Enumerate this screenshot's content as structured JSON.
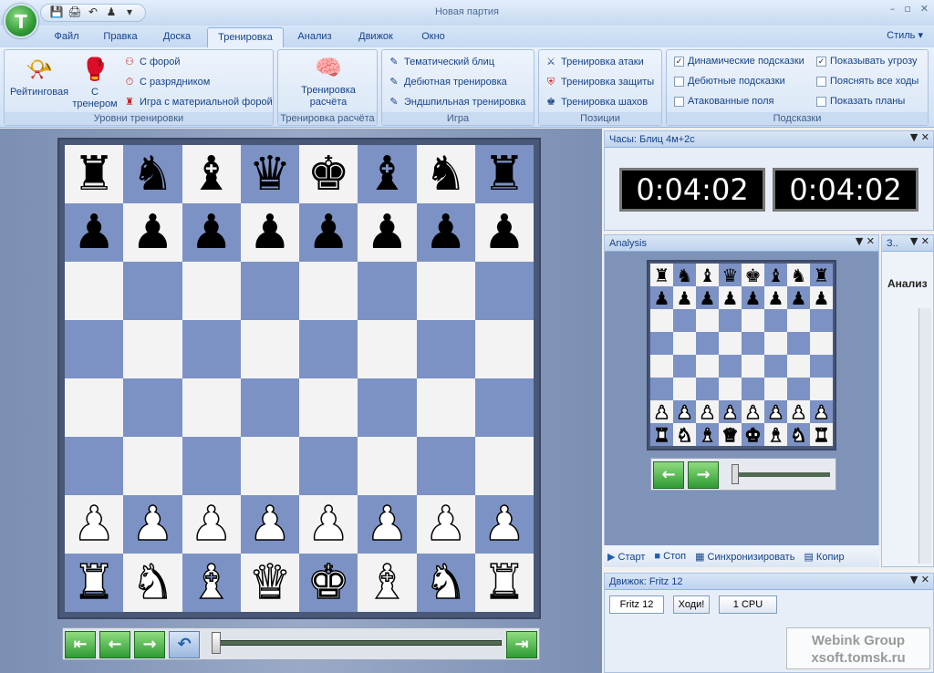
{
  "app": {
    "title": "Новая партия",
    "style_label": "Стиль ▾",
    "window_controls": [
      "–",
      "▫",
      "✕"
    ],
    "orb_glyph": "T"
  },
  "qat": {
    "items": [
      "💾",
      "🖨",
      "↶",
      "♟",
      "▾"
    ]
  },
  "tabs": [
    {
      "label": "Файл",
      "active": false
    },
    {
      "label": "Правка",
      "active": false
    },
    {
      "label": "Доска",
      "active": false
    },
    {
      "label": "Тренировка",
      "active": true
    },
    {
      "label": "Анализ",
      "active": false
    },
    {
      "label": "Движок",
      "active": false
    },
    {
      "label": "Окно",
      "active": false
    }
  ],
  "ribbon": {
    "levels": {
      "label": "Уровни тренировки",
      "rating": "Рейтинговая",
      "coach": "С тренером",
      "with_odds": "С форой",
      "with_rated": "С разрядником",
      "material_odds": "Игра с материальной форой"
    },
    "calc": {
      "label": "Тренировка расчёта",
      "button": "Тренировка расчёта"
    },
    "game": {
      "label": "Игра",
      "items": [
        "Тематический блиц",
        "Дебютная тренировка",
        "Эндшпильная тренировка"
      ]
    },
    "positions": {
      "label": "Позиции",
      "items": [
        "Тренировка атаки",
        "Тренировка защиты",
        "Тренировка шахов"
      ]
    },
    "hints": {
      "label": "Подсказки",
      "items": [
        {
          "text": "Динамические подсказки",
          "checked": true
        },
        {
          "text": "Дебютные подсказки",
          "checked": false
        },
        {
          "text": "Атакованные поля",
          "checked": false
        },
        {
          "text": "Показывать угрозу",
          "checked": true
        },
        {
          "text": "Пояснять все ходы",
          "checked": false
        },
        {
          "text": "Показать планы",
          "checked": false
        }
      ]
    }
  },
  "board": {
    "rows": [
      "rnbqkbnr",
      "pppppppp",
      "........",
      "........",
      "........",
      "........",
      "PPPPPPPP",
      "RNBQKBNR"
    ]
  },
  "nav": {
    "buttons": [
      "⇤",
      "←",
      "→",
      "↶",
      "⇥"
    ]
  },
  "clock": {
    "title": "Часы: Блиц 4м+2с",
    "white": "0:04:02",
    "black": "0:04:02"
  },
  "analysis": {
    "title": "Analysis",
    "start": "Старт",
    "stop": "Стоп",
    "sync": "Синхронизировать",
    "copy": "Копир"
  },
  "side": {
    "title": "З..",
    "label": "Анализ"
  },
  "engine": {
    "title": "Движок: Fritz 12",
    "name": "Fritz 12",
    "move_btn": "Ходи!",
    "cpu_btn": "1 CPU"
  },
  "watermark": {
    "line1": "Webink Group",
    "line2": "xsoft.tomsk.ru"
  }
}
